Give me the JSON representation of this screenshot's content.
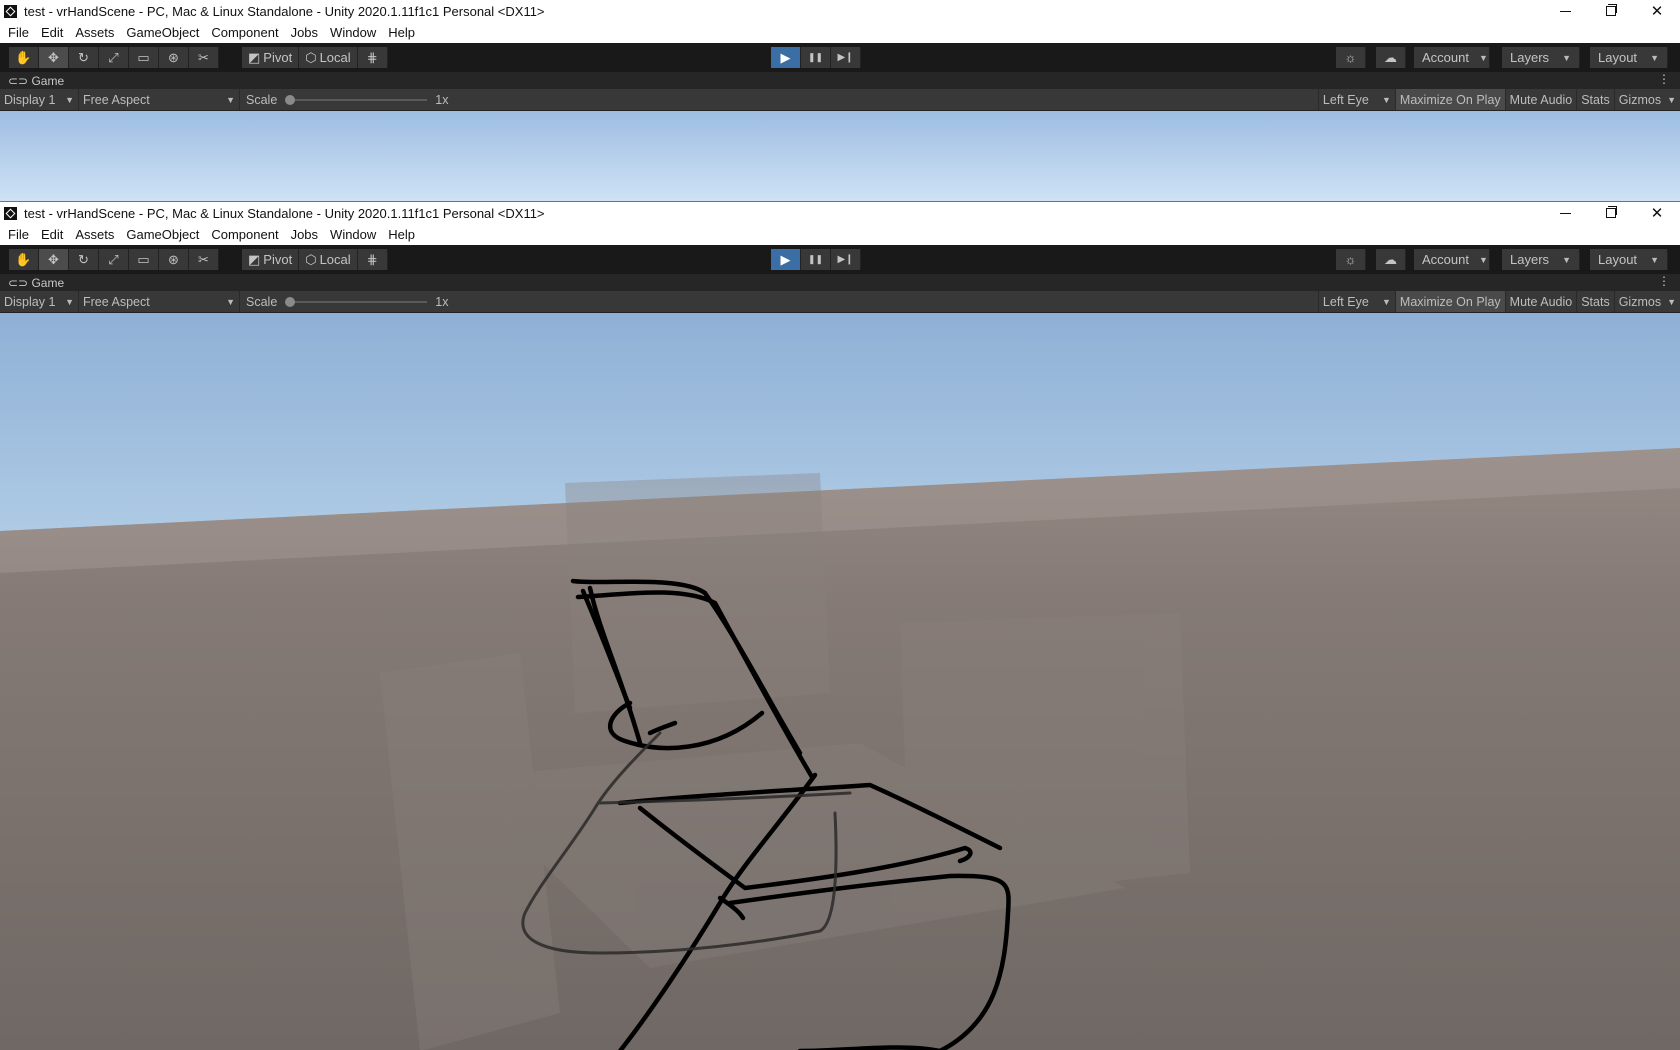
{
  "window": {
    "title": "test - vrHandScene - PC, Mac & Linux Standalone - Unity 2020.1.11f1c1 Personal <DX11>",
    "controls": {
      "minimize": "minimize-icon",
      "maximize": "restore-icon",
      "close": "close-icon",
      "close_glyph": "✕"
    }
  },
  "menu": [
    "File",
    "Edit",
    "Assets",
    "GameObject",
    "Component",
    "Jobs",
    "Window",
    "Help"
  ],
  "toolbar": {
    "tools": [
      "hand-tool-icon",
      "move-tool-icon",
      "rotate-tool-icon",
      "scale-tool-icon",
      "rect-tool-icon",
      "transform-tool-icon",
      "custom-tool-icon"
    ],
    "tool_glyphs": [
      "✋",
      "✥",
      "↻",
      "⤢",
      "▭",
      "⊛",
      "✂"
    ],
    "pivot": "Pivot",
    "local": "Local",
    "play_glyphs": [
      "▶",
      "❚❚",
      "▶❙"
    ],
    "account": "Account",
    "layers": "Layers",
    "layout": "Layout"
  },
  "game_view": {
    "tab_label": "Game",
    "display": "Display 1",
    "aspect": "Free Aspect",
    "scale_label": "Scale",
    "scale_value": "1x",
    "eye": "Left Eye",
    "maximize_on_play": "Maximize On Play",
    "mute_audio": "Mute Audio",
    "stats": "Stats",
    "gizmos": "Gizmos"
  },
  "colors": {
    "sky_top": "#9dbde2",
    "horizon": "#e8f3f6",
    "ground": "#7a726e",
    "stroke": "#000000",
    "play_accent": "#3a6ea5"
  }
}
